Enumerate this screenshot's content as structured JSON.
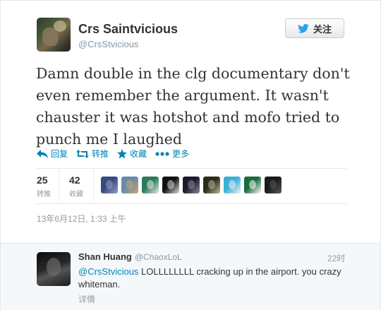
{
  "author": {
    "name": "Crs Saintvicious",
    "handle": "@CrsStvicious"
  },
  "follow_button": {
    "label": "关注",
    "icon": "twitter-bird-icon"
  },
  "tweet": {
    "text": "Damn double in the clg documentary don't even remember the argument. It wasn't chauster it was hotshot and mofo tried to punch me I laughed"
  },
  "actions": {
    "reply": "回复",
    "retweet": "转推",
    "favorite": "收藏",
    "more": "更多"
  },
  "stats": {
    "retweets": {
      "count": "25",
      "label": "转推"
    },
    "favorites": {
      "count": "42",
      "label": "收藏"
    }
  },
  "favoriters": [
    {
      "colors": [
        "#3a4a7a",
        "#8fa0c8"
      ]
    },
    {
      "colors": [
        "#6a8aa8",
        "#c8a870"
      ]
    },
    {
      "colors": [
        "#2a7a5a",
        "#e8e8e8"
      ]
    },
    {
      "colors": [
        "#111111",
        "#dddddd"
      ]
    },
    {
      "colors": [
        "#1a1a2a",
        "#8a8aa0"
      ]
    },
    {
      "colors": [
        "#2a2a1a",
        "#c0b8a0"
      ]
    },
    {
      "colors": [
        "#3ab0d8",
        "#f0f0f0"
      ]
    },
    {
      "colors": [
        "#1a6a3a",
        "#ffffff"
      ]
    },
    {
      "colors": [
        "#1a1a1a",
        "#5a5a5a"
      ]
    }
  ],
  "timestamp": "13年6月12日, 1:33 上午",
  "reply": {
    "name": "Shan Huang",
    "handle": "@ChaoxLoL",
    "time": "22时",
    "mention": "@CrsStvicious",
    "text": " LOLLLLLLLL cracking up in the airport. you crazy whiteman.",
    "details": "详情"
  }
}
